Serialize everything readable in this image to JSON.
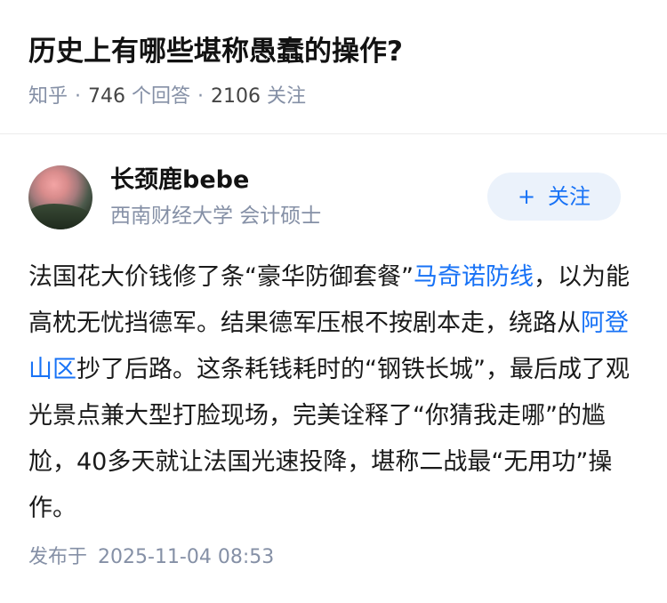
{
  "question": {
    "title": "历史上有哪些堪称愚蠢的操作?",
    "source": "知乎",
    "answer_count": "746",
    "answer_label": "个回答",
    "follower_count": "2106",
    "follower_label": "关注"
  },
  "author": {
    "name": "长颈鹿bebe",
    "headline": "西南财经大学 会计硕士",
    "follow_plus": "+",
    "follow_label": "关注"
  },
  "answer": {
    "seg1": "法国花大价钱修了条“豪华防御套餐”",
    "link1": "马奇诺防线",
    "seg2": "，以为能高枕无忧挡德军。结果德军压根不按剧本走，绕路从",
    "link2": "阿登山区",
    "seg3": "抄了后路。这条耗钱耗时的“钢铁长城”，最后成了观光景点兼大型打脸现场，完美诠释了“你猜我走哪”的尴尬，40多天就让法国光速投降，堪称二战最“无用功”操作。"
  },
  "footer": {
    "published_label": "发布于",
    "published_time": "2025-11-04 08:53"
  },
  "colors": {
    "link": "#1772f6",
    "meta": "#8590a6",
    "follow_bg": "#ebf2fb"
  }
}
